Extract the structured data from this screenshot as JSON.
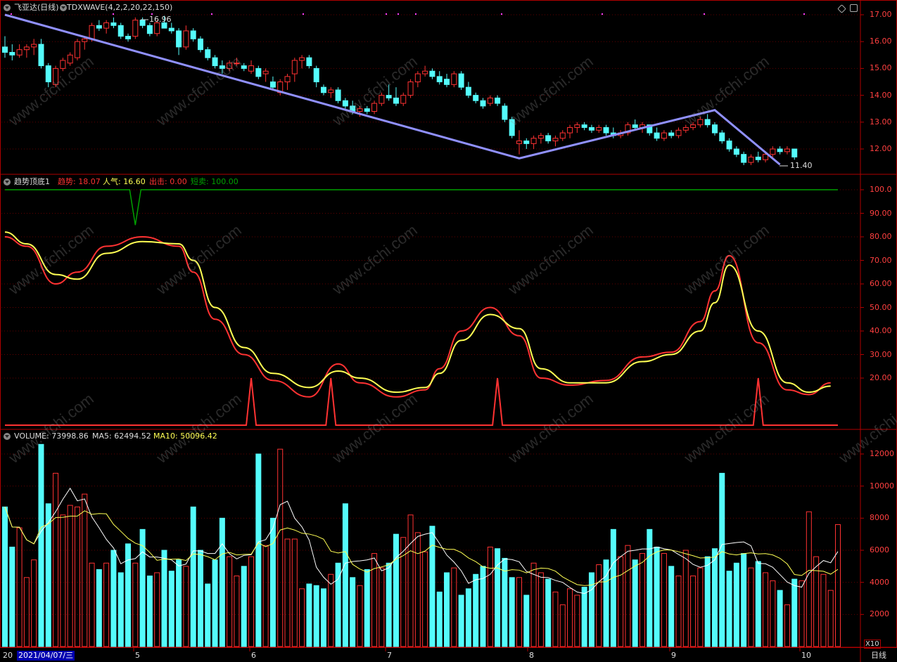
{
  "panels": {
    "price": {
      "name": "飞亚达(日线)",
      "indicator": "TDXWAVE(4,2,2,20,22,150)",
      "high_label": "16.96",
      "low_label": "11.40",
      "y_ticks": [
        "17.00",
        "16.00",
        "15.00",
        "14.00",
        "13.00",
        "12.00"
      ],
      "colors": {
        "up": "#ff3232",
        "down": "#54fcfc",
        "wave": "#9090ff"
      }
    },
    "trend": {
      "name": "趋势顶底1",
      "legend": [
        {
          "label": "趋势: 18.07",
          "color": "#ff3232"
        },
        {
          "label": "人气: 16.60",
          "color": "#ffff54"
        },
        {
          "label": "出击: 0.00",
          "color": "#ff3232"
        },
        {
          "label": "短卖: 100.00",
          "color": "#00a000"
        }
      ],
      "y_ticks": [
        "100.0",
        "90.00",
        "80.00",
        "70.00",
        "60.00",
        "50.00",
        "40.00",
        "30.00",
        "20.00"
      ]
    },
    "volume": {
      "name": "VOLUME: 73998.86",
      "ma5": "MA5: 62494.52",
      "ma10": "MA10: 50096.42",
      "y_ticks": [
        "12000",
        "10000",
        "8000",
        "6000",
        "4000",
        "2000"
      ],
      "unit": "X10"
    }
  },
  "x_axis": {
    "date_highlight": "2021/04/07/三",
    "date_prefix": "20",
    "months": [
      "5",
      "6",
      "7",
      "8",
      "9",
      "10"
    ],
    "period": "日线"
  },
  "watermark": "www.cfchi.com",
  "chart_data": [
    {
      "type": "candlestick",
      "title": "飞亚达(日线)",
      "candles": [
        [
          15.8,
          16.2,
          15.4,
          15.6
        ],
        [
          15.6,
          15.9,
          15.3,
          15.5
        ],
        [
          15.5,
          15.9,
          15.4,
          15.7
        ],
        [
          15.7,
          15.9,
          15.4,
          15.8
        ],
        [
          15.8,
          16.1,
          15.5,
          15.9
        ],
        [
          15.9,
          16.1,
          15.0,
          15.1
        ],
        [
          15.1,
          15.2,
          14.3,
          14.5
        ],
        [
          14.4,
          15.1,
          14.3,
          15.0
        ],
        [
          15.0,
          15.4,
          14.9,
          15.3
        ],
        [
          15.2,
          15.6,
          15.1,
          15.5
        ],
        [
          15.4,
          16.1,
          15.3,
          16.0
        ],
        [
          16.0,
          16.2,
          15.7,
          16.1
        ],
        [
          16.1,
          16.7,
          16.0,
          16.6
        ],
        [
          16.6,
          16.8,
          16.4,
          16.5
        ],
        [
          16.5,
          16.8,
          16.3,
          16.7
        ],
        [
          16.7,
          16.9,
          16.5,
          16.6
        ],
        [
          16.6,
          16.7,
          16.1,
          16.2
        ],
        [
          16.2,
          16.3,
          16.0,
          16.1
        ],
        [
          16.2,
          16.9,
          16.1,
          16.8
        ],
        [
          16.8,
          16.9,
          16.5,
          16.6
        ],
        [
          16.6,
          16.7,
          16.2,
          16.3
        ],
        [
          16.3,
          16.8,
          16.2,
          16.7
        ],
        [
          16.7,
          16.96,
          16.6,
          16.5
        ],
        [
          16.5,
          16.7,
          16.3,
          16.4
        ],
        [
          16.4,
          16.5,
          15.5,
          15.8
        ],
        [
          15.8,
          16.6,
          15.7,
          16.4
        ],
        [
          16.4,
          16.5,
          16.0,
          16.1
        ],
        [
          16.1,
          16.2,
          15.6,
          15.7
        ],
        [
          15.7,
          15.8,
          15.3,
          15.4
        ],
        [
          15.4,
          15.5,
          15.0,
          15.1
        ],
        [
          15.1,
          15.3,
          14.8,
          15.0
        ],
        [
          15.0,
          15.3,
          14.9,
          15.2
        ],
        [
          15.2,
          15.4,
          15.1,
          15.2
        ],
        [
          15.1,
          15.2,
          14.9,
          15.0
        ],
        [
          14.9,
          15.3,
          14.8,
          15.1
        ],
        [
          15.0,
          15.1,
          14.6,
          14.7
        ],
        [
          14.8,
          15.0,
          14.5,
          14.9
        ],
        [
          14.5,
          14.7,
          14.2,
          14.3
        ],
        [
          14.1,
          14.6,
          14.0,
          14.5
        ],
        [
          14.5,
          14.8,
          14.2,
          14.7
        ],
        [
          14.8,
          15.4,
          14.5,
          15.3
        ],
        [
          15.3,
          15.5,
          15.0,
          15.4
        ],
        [
          15.4,
          15.5,
          15.0,
          15.1
        ],
        [
          15.0,
          15.1,
          14.3,
          14.5
        ],
        [
          14.3,
          14.4,
          14.0,
          14.1
        ],
        [
          14.1,
          14.3,
          13.9,
          14.2
        ],
        [
          14.2,
          14.3,
          13.7,
          13.8
        ],
        [
          13.8,
          13.9,
          13.5,
          13.6
        ],
        [
          13.6,
          13.8,
          13.3,
          13.4
        ],
        [
          13.4,
          13.6,
          13.2,
          13.5
        ],
        [
          13.5,
          13.6,
          13.3,
          13.4
        ],
        [
          13.4,
          13.8,
          13.3,
          13.7
        ],
        [
          13.7,
          14.1,
          13.6,
          14.0
        ],
        [
          14.0,
          14.4,
          13.8,
          13.9
        ],
        [
          13.9,
          14.3,
          13.6,
          13.7
        ],
        [
          13.7,
          14.1,
          13.6,
          14.0
        ],
        [
          14.0,
          14.6,
          13.9,
          14.5
        ],
        [
          14.5,
          14.9,
          14.3,
          14.8
        ],
        [
          14.8,
          15.1,
          14.7,
          14.9
        ],
        [
          14.9,
          15.0,
          14.6,
          14.7
        ],
        [
          14.7,
          14.9,
          14.4,
          14.5
        ],
        [
          14.6,
          14.8,
          14.3,
          14.4
        ],
        [
          14.4,
          14.9,
          14.3,
          14.8
        ],
        [
          14.8,
          14.9,
          14.2,
          14.3
        ],
        [
          14.3,
          14.5,
          13.9,
          14.0
        ],
        [
          14.0,
          14.1,
          13.7,
          13.8
        ],
        [
          13.8,
          13.9,
          13.5,
          13.6
        ],
        [
          13.7,
          14.0,
          13.6,
          13.9
        ],
        [
          13.9,
          14.0,
          13.6,
          13.7
        ],
        [
          13.6,
          13.7,
          13.0,
          13.1
        ],
        [
          13.1,
          13.2,
          12.4,
          12.5
        ],
        [
          12.2,
          12.7,
          11.8,
          12.3
        ],
        [
          12.3,
          12.4,
          12.0,
          12.2
        ],
        [
          12.2,
          12.5,
          12.0,
          12.4
        ],
        [
          12.4,
          12.6,
          12.2,
          12.5
        ],
        [
          12.5,
          12.6,
          12.2,
          12.3
        ],
        [
          12.3,
          12.5,
          12.1,
          12.4
        ],
        [
          12.4,
          12.7,
          12.3,
          12.6
        ],
        [
          12.6,
          12.9,
          12.4,
          12.8
        ],
        [
          12.8,
          13.0,
          12.6,
          12.9
        ],
        [
          12.9,
          13.0,
          12.7,
          12.8
        ],
        [
          12.8,
          12.9,
          12.6,
          12.7
        ],
        [
          12.7,
          12.9,
          12.6,
          12.8
        ],
        [
          12.8,
          12.9,
          12.5,
          12.6
        ],
        [
          12.6,
          12.8,
          12.4,
          12.5
        ],
        [
          12.5,
          12.7,
          12.4,
          12.6
        ],
        [
          12.6,
          13.0,
          12.5,
          12.9
        ],
        [
          12.9,
          13.1,
          12.7,
          12.8
        ],
        [
          12.8,
          13.0,
          12.6,
          12.9
        ],
        [
          12.9,
          12.9,
          12.5,
          12.6
        ],
        [
          12.6,
          12.8,
          12.3,
          12.4
        ],
        [
          12.4,
          12.7,
          12.3,
          12.6
        ],
        [
          12.6,
          12.7,
          12.4,
          12.5
        ],
        [
          12.5,
          12.8,
          12.4,
          12.7
        ],
        [
          12.7,
          12.9,
          12.6,
          12.8
        ],
        [
          12.8,
          13.0,
          12.7,
          12.9
        ],
        [
          12.9,
          13.2,
          12.8,
          13.1
        ],
        [
          13.1,
          13.3,
          12.8,
          12.9
        ],
        [
          12.9,
          13.0,
          12.5,
          12.6
        ],
        [
          12.6,
          12.7,
          12.2,
          12.3
        ],
        [
          12.3,
          12.4,
          11.9,
          12.0
        ],
        [
          12.0,
          12.1,
          11.7,
          11.8
        ],
        [
          11.8,
          11.9,
          11.4,
          11.5
        ],
        [
          11.5,
          11.8,
          11.4,
          11.7
        ],
        [
          11.7,
          11.9,
          11.5,
          11.6
        ],
        [
          11.6,
          11.9,
          11.5,
          11.8
        ],
        [
          11.8,
          12.1,
          11.7,
          12.0
        ],
        [
          12.0,
          12.1,
          11.8,
          11.9
        ],
        [
          11.9,
          12.1,
          11.8,
          12.0
        ],
        [
          12.0,
          12.0,
          11.6,
          11.7
        ]
      ],
      "wave_points": [
        {
          "index": 0,
          "value": 17.0
        },
        {
          "index": 71,
          "value": 11.65
        },
        {
          "index": 98,
          "value": 13.45
        },
        {
          "index": 107,
          "value": 11.42
        }
      ],
      "annotations": [
        "16.96",
        "11.40"
      ],
      "ylim": [
        11.0,
        17.25
      ]
    },
    {
      "type": "line",
      "title": "趋势顶底1",
      "ylim": [
        0,
        105
      ],
      "series": [
        {
          "name": "趋势",
          "color": "#ff3232",
          "x": [
            0,
            3,
            7,
            10,
            14,
            19,
            24,
            26,
            29,
            33,
            37,
            42,
            46,
            49,
            54,
            58,
            60,
            63,
            67,
            71,
            74,
            78,
            83,
            88,
            92,
            96,
            98,
            100,
            104,
            108,
            111,
            114
          ],
          "values": [
            80,
            76,
            60,
            65,
            76,
            80,
            76,
            65,
            45,
            30,
            19,
            12,
            26,
            18,
            12,
            15,
            24,
            40,
            50,
            38,
            20,
            17,
            19,
            29,
            31,
            44,
            57,
            72,
            35,
            15,
            13,
            18
          ]
        },
        {
          "name": "人气",
          "color": "#ffff54",
          "x": [
            0,
            3,
            7,
            10,
            14,
            19,
            24,
            26,
            29,
            33,
            37,
            42,
            46,
            49,
            54,
            58,
            60,
            63,
            67,
            71,
            74,
            78,
            83,
            88,
            92,
            96,
            98,
            100,
            104,
            108,
            111,
            114
          ],
          "values": [
            82,
            77,
            64,
            62,
            73,
            78,
            77,
            70,
            50,
            33,
            22,
            16,
            23,
            20,
            14,
            16,
            22,
            36,
            47,
            41,
            24,
            18,
            18,
            27,
            30,
            40,
            52,
            68,
            40,
            18,
            14,
            16.6
          ]
        },
        {
          "name": "出击",
          "color": "#ff3232",
          "type": "spikes",
          "base": 0,
          "spikes": [
            {
              "x": 34,
              "value": 20
            },
            {
              "x": 45,
              "value": 20
            },
            {
              "x": 68,
              "value": 20
            },
            {
              "x": 104,
              "value": 20
            }
          ]
        },
        {
          "name": "短卖",
          "color": "#00a000",
          "type": "level",
          "base": 100,
          "dips": [
            {
              "x": 18,
              "value": 85
            }
          ]
        }
      ]
    },
    {
      "type": "bar",
      "title": "VOLUME",
      "ylim": [
        0,
        12500
      ],
      "values": [
        8700,
        6200,
        7400,
        4300,
        5400,
        12600,
        8900,
        10800,
        8200,
        8800,
        8700,
        9500,
        5200,
        4800,
        5200,
        6000,
        4600,
        6400,
        5200,
        7300,
        4400,
        4600,
        6000,
        4700,
        5400,
        5000,
        8700,
        6000,
        3900,
        5400,
        8000,
        5600,
        4400,
        5000,
        5600,
        12000,
        6300,
        8000,
        12300,
        6700,
        6700,
        3600,
        3900,
        3800,
        3600,
        4500,
        5200,
        8900,
        4300,
        3800,
        4800,
        5800,
        4900,
        5200,
        7000,
        6800,
        8200,
        7100,
        5900,
        7500,
        3400,
        4600,
        4900,
        3200,
        3600,
        4500,
        5000,
        6200,
        6100,
        5500,
        4300,
        4300,
        3200,
        5200,
        4600,
        4200,
        3400,
        2600,
        3600,
        3200,
        3700,
        4600,
        5100,
        5400,
        7300,
        5600,
        6300,
        5400,
        5800,
        7300,
        6200,
        5800,
        5000,
        4400,
        6000,
        4400,
        4900,
        5600,
        6100,
        10800,
        4700,
        5200,
        5800,
        4900,
        5300,
        4600,
        4100,
        3500,
        2600,
        4200,
        4100,
        8400,
        5600,
        4500,
        3500,
        7600
      ],
      "ma5_label": "MA5: 62494.52",
      "ma10_label": "MA10: 50096.42"
    }
  ]
}
